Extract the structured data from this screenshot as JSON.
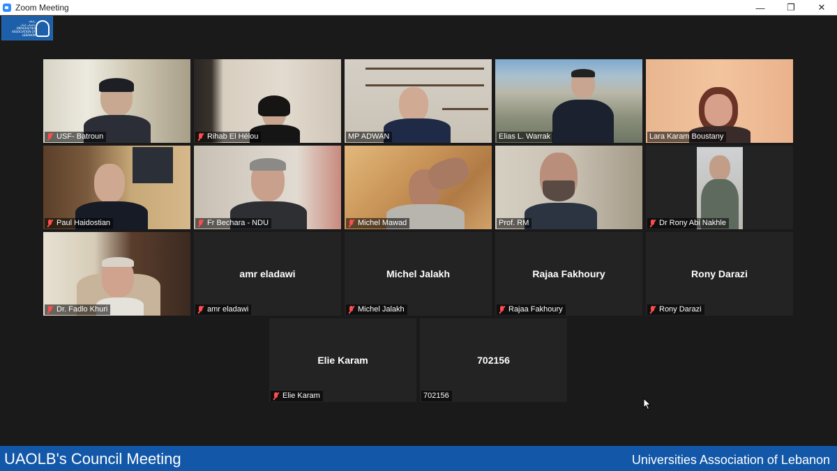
{
  "window": {
    "title": "Zoom Meeting",
    "minimize": "—",
    "restore": "❐",
    "close": "✕"
  },
  "logo": {
    "text_line1": "رابطة",
    "text_line2": "جامعات لبنان",
    "text_line3": "UNIVERSITIES ASSOCIATION OF LEBANON"
  },
  "tiles": [
    {
      "label": "USF- Batroun",
      "muted": true,
      "video": true
    },
    {
      "label": "Rihab El Hélou",
      "muted": true,
      "video": true
    },
    {
      "label": "MP ADWAN",
      "muted": false,
      "video": true,
      "active": true
    },
    {
      "label": "Elias L. Warrak",
      "muted": false,
      "video": true
    },
    {
      "label": "Lara Karam Boustany",
      "muted": false,
      "video": true
    },
    {
      "label": "Paul Haidostian",
      "muted": true,
      "video": true
    },
    {
      "label": "Fr Bechara - NDU",
      "muted": true,
      "video": true
    },
    {
      "label": "Michel Mawad",
      "muted": true,
      "video": true
    },
    {
      "label": "Prof. RM",
      "muted": false,
      "video": true
    },
    {
      "label": "Dr Rony Abi Nakhle",
      "muted": true,
      "video": true
    },
    {
      "label": "Dr. Fadlo Khuri",
      "muted": true,
      "video": true
    },
    {
      "label": "amr eladawi",
      "name": "amr eladawi",
      "muted": true,
      "video": false
    },
    {
      "label": "Michel Jalakh",
      "name": "Michel Jalakh",
      "muted": true,
      "video": false
    },
    {
      "label": "Rajaa Fakhoury",
      "name": "Rajaa Fakhoury",
      "muted": true,
      "video": false
    },
    {
      "label": "Rony Darazi",
      "name": "Rony Darazi",
      "muted": true,
      "video": false
    },
    {
      "label": "Elie Karam",
      "name": "Elie Karam",
      "muted": true,
      "video": false
    },
    {
      "label": "702156",
      "name": "702156",
      "muted": false,
      "video": false
    }
  ],
  "footer": {
    "left": "UAOLB's Council Meeting",
    "right": "Universities Association of Lebanon"
  },
  "colors": {
    "accent_active": "#b9e34a",
    "footer_bg": "#1257a8",
    "muted_icon": "#ff4d4d"
  }
}
